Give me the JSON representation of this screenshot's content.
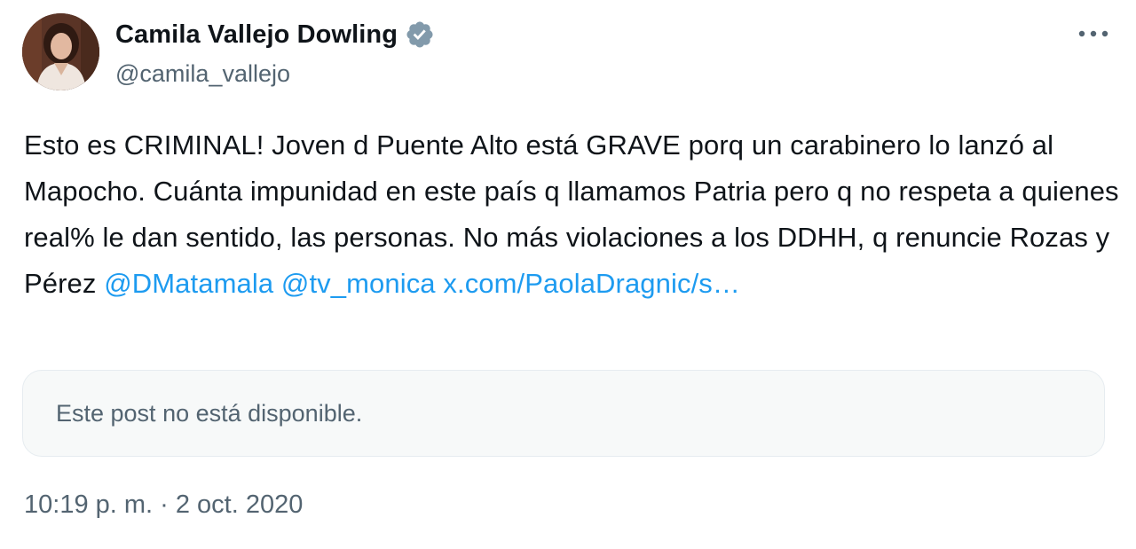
{
  "author": {
    "display_name": "Camila Vallejo Dowling",
    "handle": "@camila_vallejo",
    "verified_color": "#829aab"
  },
  "menu": {
    "icon": "more-horizontal-icon"
  },
  "tweet": {
    "text_segments": [
      "Esto es CRIMINAL! Joven d Puente Alto está GRAVE porq un carabinero lo lanzó al Mapocho. Cuánta impunidad en este país q llamamos Patria pero q no respeta a quienes real% le dan sentido, las personas. No más violaciones a los DDHH, q renuncie Rozas y Pérez ",
      "@DMatamala",
      " ",
      "@tv_monica",
      " ",
      "x.com/PaolaDragnic/s…"
    ],
    "link_color": "#1d9bf0"
  },
  "quoted_post": {
    "message": "Este post no está disponible."
  },
  "timestamp": "10:19 p. m. · 2 oct. 2020"
}
